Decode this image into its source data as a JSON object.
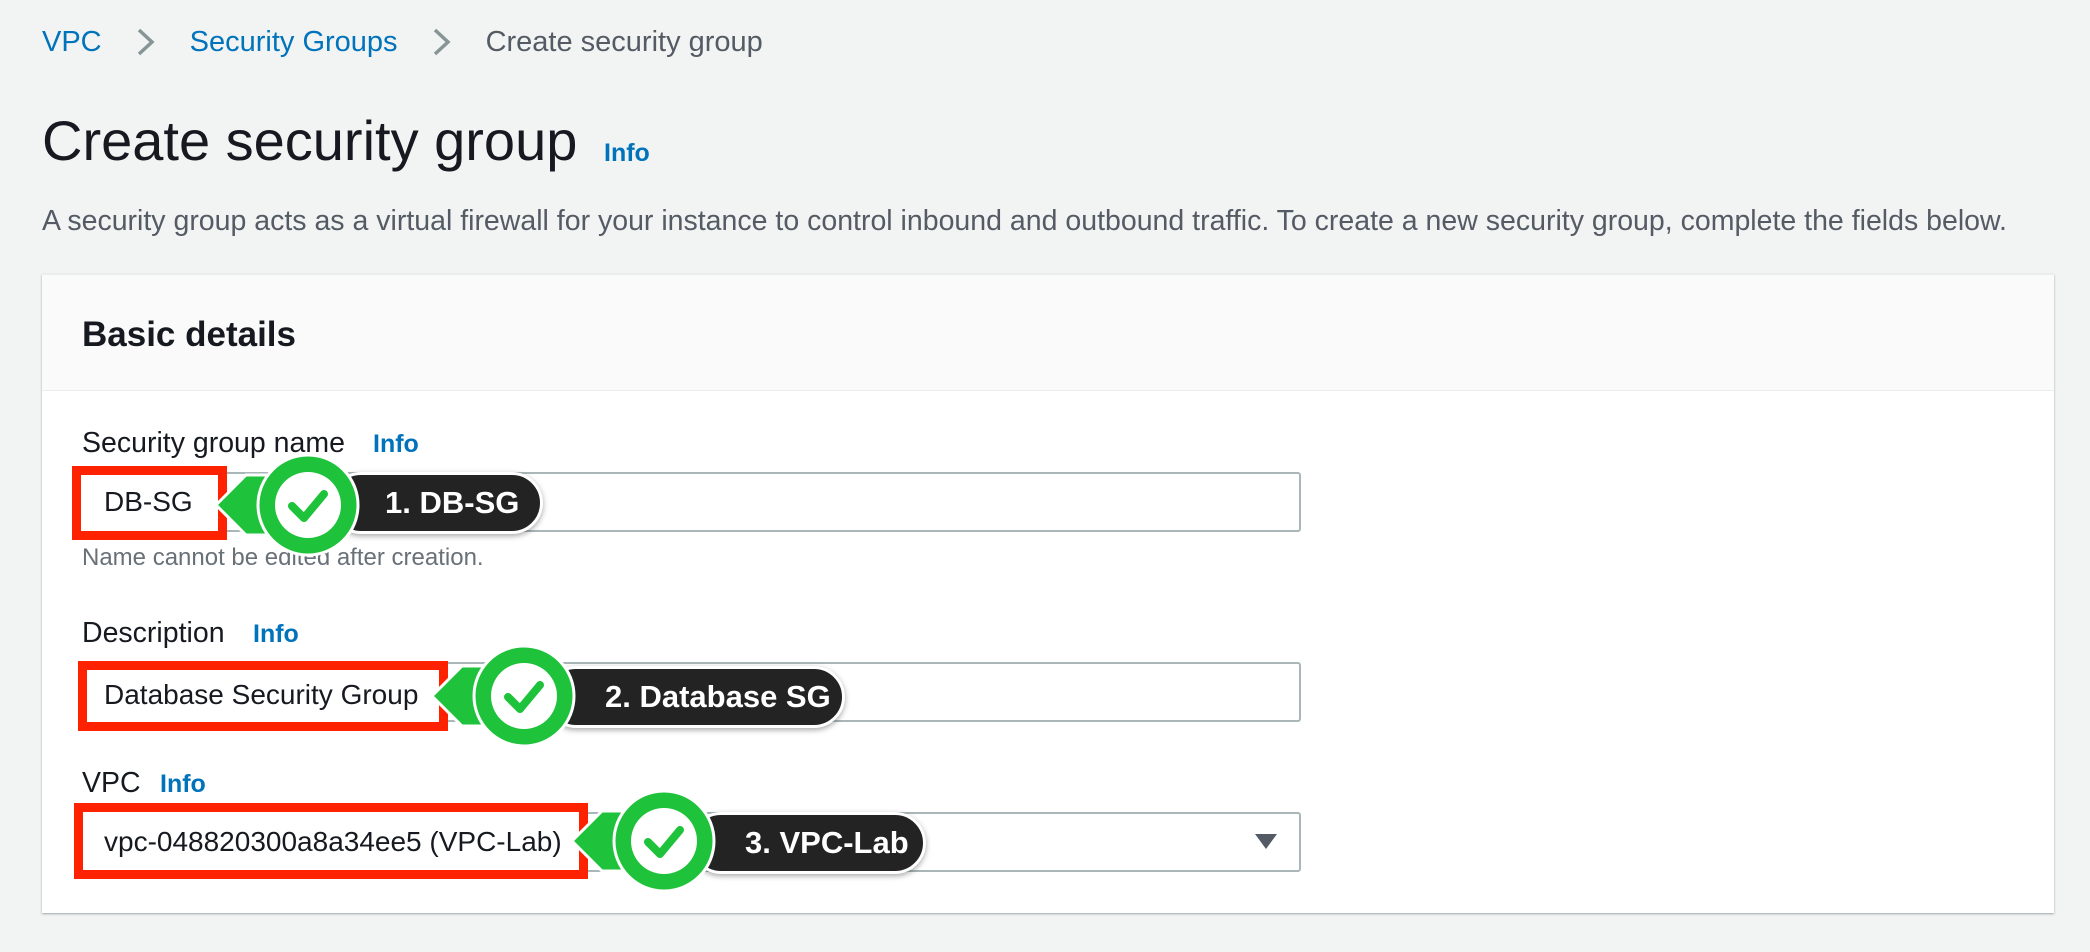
{
  "breadcrumb": {
    "items": [
      {
        "label": "VPC"
      },
      {
        "label": "Security Groups"
      },
      {
        "label": "Create security group"
      }
    ]
  },
  "page": {
    "title": "Create security group",
    "title_info": "Info",
    "description": "A security group acts as a virtual firewall for your instance to control inbound and outbound traffic. To create a new security group, complete the fields below."
  },
  "panel": {
    "title": "Basic details",
    "fields": {
      "name": {
        "label": "Security group name",
        "info": "Info",
        "value": "DB-SG",
        "hint": "Name cannot be edited after creation."
      },
      "description": {
        "label": "Description",
        "info": "Info",
        "value": "Database Security Group"
      },
      "vpc": {
        "label": "VPC",
        "info": "Info",
        "value": "vpc-048820300a8a34ee5 (VPC-Lab)"
      }
    }
  },
  "callouts": [
    {
      "text": "1. DB-SG"
    },
    {
      "text": "2. Database SG"
    },
    {
      "text": "3. VPC-Lab"
    }
  ],
  "colors": {
    "link": "#0073bb",
    "highlight": "#ff2200",
    "check_green": "#1ec33b",
    "pill": "#232323"
  }
}
